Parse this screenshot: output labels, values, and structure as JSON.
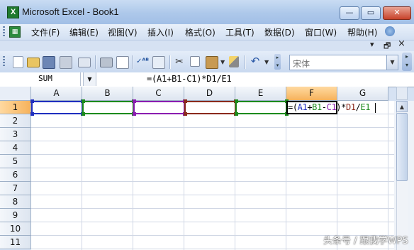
{
  "window": {
    "title": "Microsoft Excel - Book1",
    "app_icon_letter": "X"
  },
  "menu": {
    "items": [
      "文件(F)",
      "编辑(E)",
      "视图(V)",
      "插入(I)",
      "格式(O)",
      "工具(T)",
      "数据(D)",
      "窗口(W)",
      "帮助(H)"
    ],
    "doc_minimize": "▾",
    "doc_restore": "🗗",
    "doc_close": "×"
  },
  "toolbar": {
    "font_name": "宋体"
  },
  "formula_bar": {
    "name_box": "SUM",
    "formula": "=(A1+B1-C1)*D1/E1"
  },
  "grid": {
    "columns": [
      "A",
      "B",
      "C",
      "D",
      "E",
      "F",
      "G"
    ],
    "rows": [
      "1",
      "2",
      "3",
      "4",
      "5",
      "6",
      "7",
      "8",
      "9",
      "10",
      "11"
    ],
    "active_column": "F",
    "active_row": "1",
    "active_cell_formula": [
      {
        "text": "=(",
        "color": "#000000"
      },
      {
        "text": "A1",
        "color": "#1f2fbf"
      },
      {
        "text": "+",
        "color": "#000000"
      },
      {
        "text": "B1",
        "color": "#1c8a1c"
      },
      {
        "text": "-",
        "color": "#000000"
      },
      {
        "text": "C1",
        "color": "#8a1cb0"
      },
      {
        "text": ")*",
        "color": "#000000"
      },
      {
        "text": "D1",
        "color": "#8a2a1c"
      },
      {
        "text": "/",
        "color": "#000000"
      },
      {
        "text": "E1",
        "color": "#1c8a1c"
      }
    ],
    "reference_colors": {
      "A1": "#1f2fbf",
      "B1": "#1c8a1c",
      "C1": "#8a1cb0",
      "D1": "#8a2a1c",
      "E1": "#1c8a1c"
    }
  },
  "watermark": "头条号 / 跟我学WPS"
}
